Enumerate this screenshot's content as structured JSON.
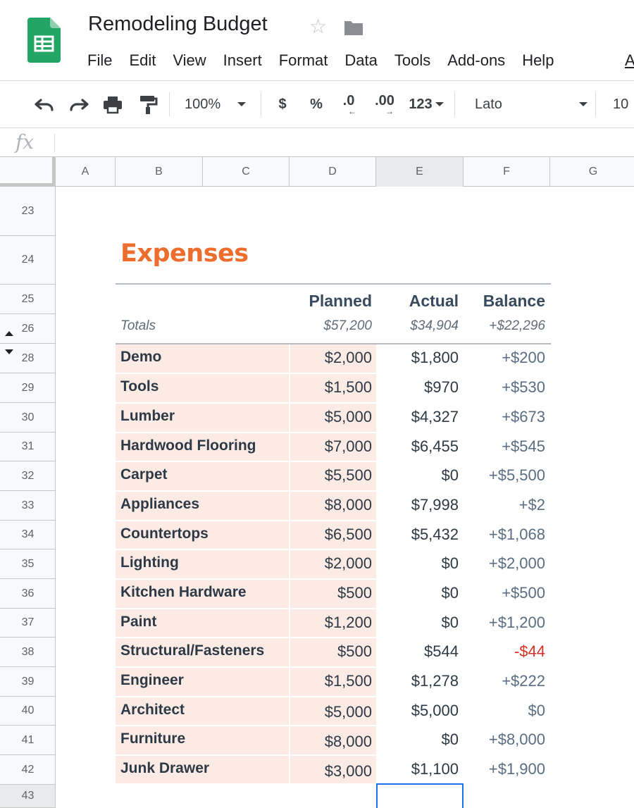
{
  "app": {
    "title": "Remodeling Budget",
    "accent": "#0f9d58"
  },
  "menu": [
    "File",
    "Edit",
    "View",
    "Insert",
    "Format",
    "Data",
    "Tools",
    "Add-ons",
    "Help"
  ],
  "menu_more": "A",
  "toolbar": {
    "zoom": "100%",
    "currency": "$",
    "percent": "%",
    "decrease_decimals": ".0",
    "increase_decimals": ".00",
    "more_formats": "123",
    "font": "Lato",
    "font_size": "10"
  },
  "formula_bar": {
    "fx": "fx",
    "value": ""
  },
  "columns": [
    "A",
    "B",
    "C",
    "D",
    "E",
    "F",
    "G"
  ],
  "selected_column": "E",
  "rows": [
    "23",
    "24",
    "25",
    "26",
    "28",
    "29",
    "30",
    "31",
    "32",
    "33",
    "34",
    "35",
    "36",
    "37",
    "38",
    "39",
    "40",
    "41",
    "42",
    "43"
  ],
  "sheet": {
    "section_title": "Expenses",
    "title_color": "#ec6d2e",
    "headers": {
      "planned": "Planned",
      "actual": "Actual",
      "balance": "Balance"
    },
    "totals": {
      "label": "Totals",
      "planned": "$57,200",
      "actual": "$34,904",
      "balance": "+$22,296"
    },
    "items": [
      {
        "name": "Demo",
        "planned": "$2,000",
        "actual": "$1,800",
        "balance": "+$200"
      },
      {
        "name": "Tools",
        "planned": "$1,500",
        "actual": "$970",
        "balance": "+$530"
      },
      {
        "name": "Lumber",
        "planned": "$5,000",
        "actual": "$4,327",
        "balance": "+$673"
      },
      {
        "name": "Hardwood Flooring",
        "planned": "$7,000",
        "actual": "$6,455",
        "balance": "+$545"
      },
      {
        "name": "Carpet",
        "planned": "$5,500",
        "actual": "$0",
        "balance": "+$5,500"
      },
      {
        "name": "Appliances",
        "planned": "$8,000",
        "actual": "$7,998",
        "balance": "+$2"
      },
      {
        "name": "Countertops",
        "planned": "$6,500",
        "actual": "$5,432",
        "balance": "+$1,068"
      },
      {
        "name": "Lighting",
        "planned": "$2,000",
        "actual": "$0",
        "balance": "+$2,000"
      },
      {
        "name": "Kitchen Hardware",
        "planned": "$500",
        "actual": "$0",
        "balance": "+$500"
      },
      {
        "name": "Paint",
        "planned": "$1,200",
        "actual": "$0",
        "balance": "+$1,200"
      },
      {
        "name": "Structural/Fasteners",
        "planned": "$500",
        "actual": "$544",
        "balance": "-$44"
      },
      {
        "name": "Engineer",
        "planned": "$1,500",
        "actual": "$1,278",
        "balance": "+$222"
      },
      {
        "name": "Architect",
        "planned": "$5,000",
        "actual": "$5,000",
        "balance": "$0"
      },
      {
        "name": "Furniture",
        "planned": "$8,000",
        "actual": "$0",
        "balance": "+$8,000"
      },
      {
        "name": "Junk Drawer",
        "planned": "$3,000",
        "actual": "$1,100",
        "balance": "+$1,900"
      }
    ],
    "colors": {
      "band": "#fcebe5",
      "text": "#2d3a45",
      "negative": "#d93025",
      "active_border": "#1a73e8"
    }
  }
}
